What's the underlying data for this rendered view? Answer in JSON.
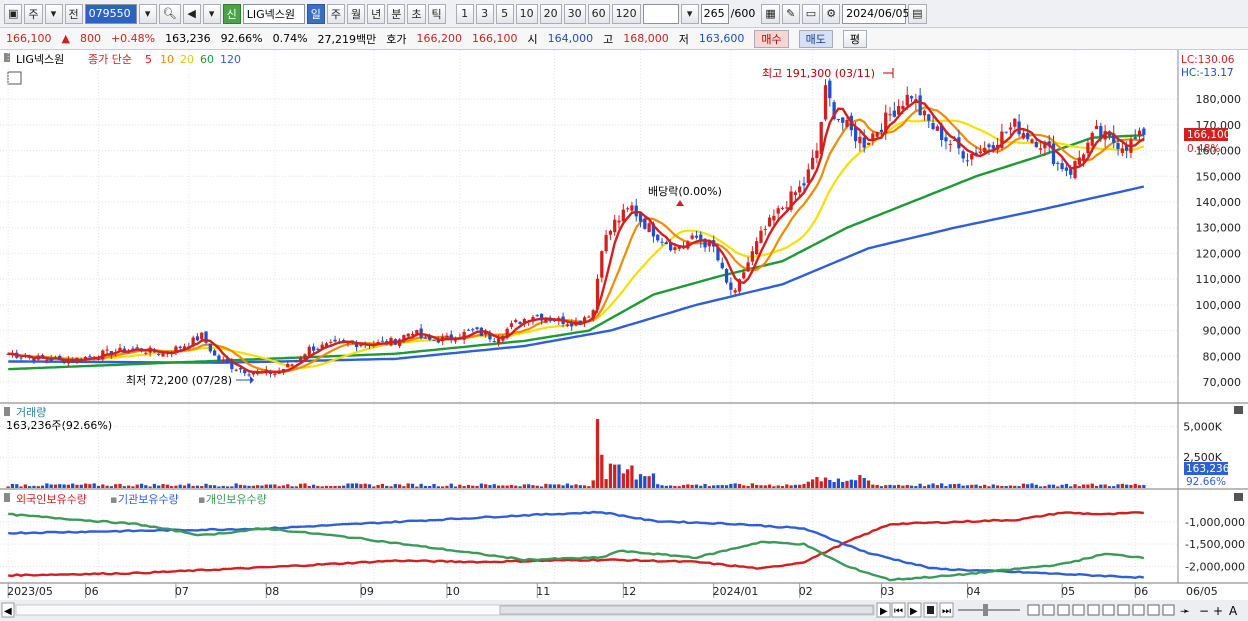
{
  "toolbar": {
    "market": "주",
    "prev": "전",
    "code": "079550",
    "badge": "신",
    "name": "LIG넥스원",
    "periods": [
      "일",
      "주",
      "월",
      "년",
      "분",
      "초",
      "틱"
    ],
    "active_period": "일",
    "intervals": [
      "1",
      "3",
      "5",
      "10",
      "20",
      "30",
      "60",
      "120"
    ],
    "count": "265",
    "count_total": "/600",
    "date": "2024/06/05"
  },
  "quote": {
    "price": "166,100",
    "change_arrow": "▲",
    "change": "800",
    "change_pct": "+0.48%",
    "volume": "163,236",
    "volume_pct": "92.66%",
    "turnover_pct": "0.74%",
    "amount": "27,219백만",
    "ask_label": "호가",
    "ask": "166,200",
    "bid": "166,100",
    "open_label": "시",
    "open": "164,000",
    "high_label": "고",
    "high": "168,000",
    "low_label": "저",
    "low": "163,600",
    "buy_label": "매수",
    "sell_label": "매도",
    "eval_label": "평"
  },
  "price_panel": {
    "title": "LIG넥스원",
    "ma_legend": "종가 단순",
    "ma_periods": [
      "5",
      "10",
      "20",
      "60",
      "120"
    ],
    "ma_colors": [
      "#d21f1f",
      "#f08a00",
      "#f5e000",
      "#1e9a35",
      "#2f5fd8"
    ],
    "lc": "LC:130.06",
    "hc": "HC:-13.17",
    "max_annotation": "최고 191,300 (03/11)",
    "min_annotation": "최저 72,200 (07/28)",
    "dividend_annotation": "배당락(0.00%)",
    "price_tag": "166,100",
    "pct_tag": "0.48%",
    "up_color": "#d21f1f",
    "down_color": "#1f4fd1"
  },
  "volume_panel": {
    "title": "거래량",
    "info": "163,236주(92.66%)",
    "tag": "163,236",
    "pct_tag": "92.66%"
  },
  "holding_panel": {
    "legend": [
      "외국인보유수량",
      "기관보유수량",
      "개인보유수량"
    ],
    "colors": [
      "#d21f1f",
      "#2f5fd8",
      "#3a9a5a"
    ]
  },
  "time_axis": {
    "labels": [
      "2023/05",
      "06",
      "07",
      "08",
      "09",
      "10",
      "11",
      "12",
      "2024/01",
      "02",
      "03",
      "04",
      "05",
      "06",
      "06/05"
    ]
  },
  "chart_data": {
    "type": "line",
    "title": "LIG넥스원",
    "price_axis": {
      "ticks": [
        70000,
        80000,
        90000,
        100000,
        110000,
        120000,
        130000,
        140000,
        150000,
        160000,
        170000,
        180000
      ],
      "tick_labels": [
        "70,000",
        "80,000",
        "90,000",
        "100,000",
        "110,000",
        "120,000",
        "130,000",
        "140,000",
        "150,000",
        "160,000",
        "170,000",
        "180,000"
      ],
      "range": [
        63000,
        196000
      ]
    },
    "volume_axis": {
      "tick_labels": [
        "5,000K",
        "2,500K"
      ],
      "ticks": [
        5000,
        2500
      ],
      "range": [
        0,
        6500
      ]
    },
    "holding_axis": {
      "tick_labels": [
        "-1,000,000",
        "-1,500,000",
        "-2,000,000"
      ],
      "ticks": [
        -1000000,
        -1500000,
        -2000000
      ],
      "range": [
        -2350000,
        -620000
      ]
    },
    "close_keypoints": [
      [
        0,
        81000
      ],
      [
        8,
        79000
      ],
      [
        15,
        78500
      ],
      [
        22,
        81000
      ],
      [
        30,
        83000
      ],
      [
        36,
        81000
      ],
      [
        42,
        85000
      ],
      [
        45,
        88000
      ],
      [
        48,
        80000
      ],
      [
        52,
        76000
      ],
      [
        56,
        74000
      ],
      [
        62,
        73500
      ],
      [
        66,
        77000
      ],
      [
        70,
        83000
      ],
      [
        78,
        85000
      ],
      [
        86,
        85000
      ],
      [
        90,
        86000
      ],
      [
        94,
        90000
      ],
      [
        97,
        86000
      ],
      [
        103,
        87000
      ],
      [
        108,
        90000
      ],
      [
        113,
        87000
      ],
      [
        118,
        93000
      ],
      [
        122,
        96000
      ],
      [
        128,
        94000
      ],
      [
        132,
        93000
      ],
      [
        136,
        98000
      ],
      [
        138,
        123000
      ],
      [
        141,
        132000
      ],
      [
        145,
        138000
      ],
      [
        147,
        133000
      ],
      [
        151,
        127000
      ],
      [
        155,
        122000
      ],
      [
        160,
        126000
      ],
      [
        164,
        122000
      ],
      [
        167,
        108000
      ],
      [
        169,
        104000
      ],
      [
        171,
        113000
      ],
      [
        175,
        127000
      ],
      [
        178,
        134000
      ],
      [
        181,
        140000
      ],
      [
        185,
        147000
      ],
      [
        188,
        160000
      ],
      [
        190,
        183000
      ],
      [
        192,
        175000
      ],
      [
        196,
        167000
      ],
      [
        199,
        163000
      ],
      [
        203,
        170000
      ],
      [
        207,
        178000
      ],
      [
        210,
        182000
      ],
      [
        212,
        175000
      ],
      [
        215,
        169000
      ],
      [
        219,
        163000
      ],
      [
        223,
        158000
      ],
      [
        227,
        161000
      ],
      [
        231,
        166000
      ],
      [
        234,
        170000
      ],
      [
        237,
        166000
      ],
      [
        241,
        162000
      ],
      [
        244,
        155000
      ],
      [
        247,
        152000
      ],
      [
        250,
        160000
      ],
      [
        253,
        167000
      ],
      [
        256,
        164000
      ],
      [
        260,
        162000
      ],
      [
        264,
        166100
      ]
    ],
    "ma120_keypoints": [
      [
        0,
        78000
      ],
      [
        50,
        77500
      ],
      [
        90,
        79000
      ],
      [
        120,
        84000
      ],
      [
        140,
        90000
      ],
      [
        160,
        100000
      ],
      [
        180,
        108000
      ],
      [
        200,
        122000
      ],
      [
        220,
        130000
      ],
      [
        240,
        137000
      ],
      [
        264,
        146000
      ]
    ],
    "ma60_keypoints": [
      [
        0,
        75000
      ],
      [
        30,
        77000
      ],
      [
        60,
        79000
      ],
      [
        90,
        81000
      ],
      [
        120,
        86000
      ],
      [
        135,
        90000
      ],
      [
        150,
        104000
      ],
      [
        165,
        111000
      ],
      [
        180,
        117000
      ],
      [
        195,
        130000
      ],
      [
        210,
        140000
      ],
      [
        225,
        150000
      ],
      [
        240,
        158000
      ],
      [
        252,
        165000
      ],
      [
        264,
        166000
      ]
    ],
    "holding_foreign_keypoints": [
      [
        0,
        -2200000
      ],
      [
        30,
        -2150000
      ],
      [
        60,
        -2020000
      ],
      [
        90,
        -1870000
      ],
      [
        110,
        -1900000
      ],
      [
        125,
        -1870000
      ],
      [
        140,
        -1850000
      ],
      [
        160,
        -1900000
      ],
      [
        175,
        -2050000
      ],
      [
        185,
        -1900000
      ],
      [
        195,
        -1450000
      ],
      [
        205,
        -1050000
      ],
      [
        220,
        -1000000
      ],
      [
        235,
        -950000
      ],
      [
        245,
        -790000
      ],
      [
        255,
        -830000
      ],
      [
        264,
        -790000
      ]
    ],
    "holding_institution_keypoints": [
      [
        0,
        -1250000
      ],
      [
        30,
        -1200000
      ],
      [
        60,
        -1150000
      ],
      [
        90,
        -1000000
      ],
      [
        120,
        -850000
      ],
      [
        138,
        -780000
      ],
      [
        150,
        -980000
      ],
      [
        170,
        -1050000
      ],
      [
        185,
        -1150000
      ],
      [
        200,
        -1700000
      ],
      [
        215,
        -2050000
      ],
      [
        240,
        -2150000
      ],
      [
        264,
        -2250000
      ]
    ],
    "holding_individual_keypoints": [
      [
        0,
        -830000
      ],
      [
        30,
        -1050000
      ],
      [
        45,
        -1300000
      ],
      [
        60,
        -1150000
      ],
      [
        80,
        -1350000
      ],
      [
        100,
        -1600000
      ],
      [
        120,
        -1850000
      ],
      [
        138,
        -1800000
      ],
      [
        142,
        -1650000
      ],
      [
        160,
        -1800000
      ],
      [
        175,
        -1450000
      ],
      [
        185,
        -1500000
      ],
      [
        195,
        -2000000
      ],
      [
        205,
        -2300000
      ],
      [
        220,
        -2200000
      ],
      [
        235,
        -2050000
      ],
      [
        245,
        -1950000
      ],
      [
        255,
        -1720000
      ],
      [
        264,
        -1800000
      ]
    ],
    "volume_spike": {
      "bar": 137,
      "value": 5600
    }
  }
}
